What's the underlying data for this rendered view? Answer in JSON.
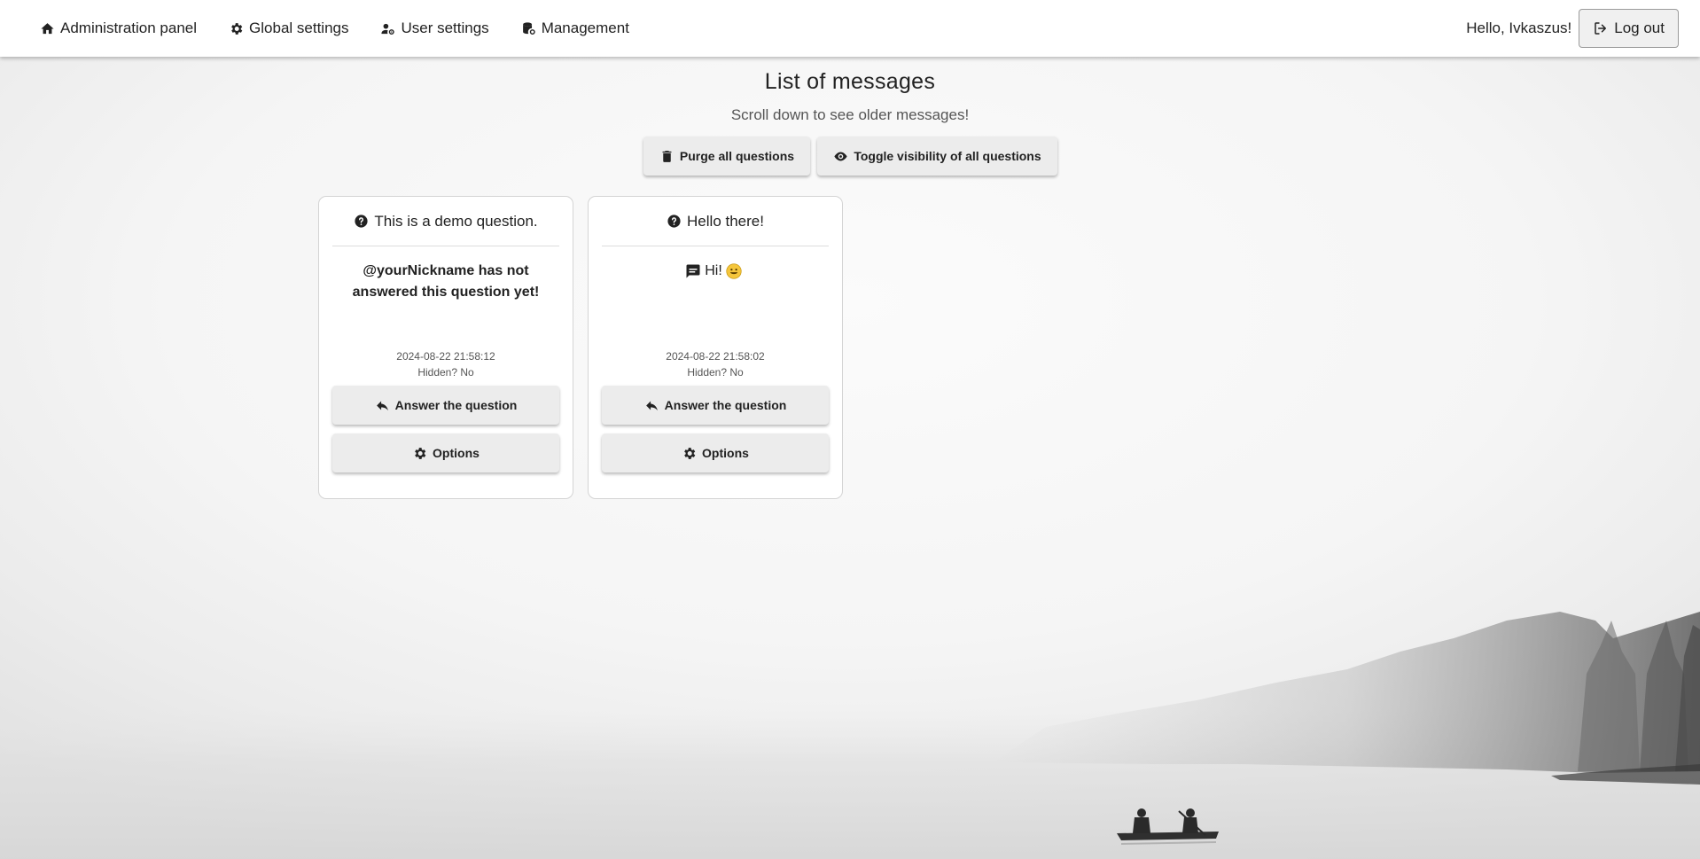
{
  "nav": {
    "items": [
      {
        "label": "Administration panel",
        "icon": "home-icon"
      },
      {
        "label": "Global settings",
        "icon": "gear-icon"
      },
      {
        "label": "User settings",
        "icon": "user-gear-icon"
      },
      {
        "label": "Management",
        "icon": "database-gear-icon"
      }
    ],
    "greeting": "Hello, Ivkaszus!",
    "logout_label": "Log out"
  },
  "page": {
    "title": "List of messages",
    "subtitle": "Scroll down to see older messages!",
    "purge_label": "Purge all questions",
    "toggle_label": "Toggle visibility of all questions"
  },
  "cards": [
    {
      "question": "This is a demo question.",
      "body": "@yourNickname has not answered this question yet!",
      "timestamp": "2024-08-22 21:58:12",
      "hidden": "Hidden? No",
      "answer_button": "Answer the question",
      "options_button": "Options"
    },
    {
      "question": "Hello there!",
      "body": "Hi!",
      "timestamp": "2024-08-22 21:58:02",
      "hidden": "Hidden? No",
      "answer_button": "Answer the question",
      "options_button": "Options"
    }
  ]
}
